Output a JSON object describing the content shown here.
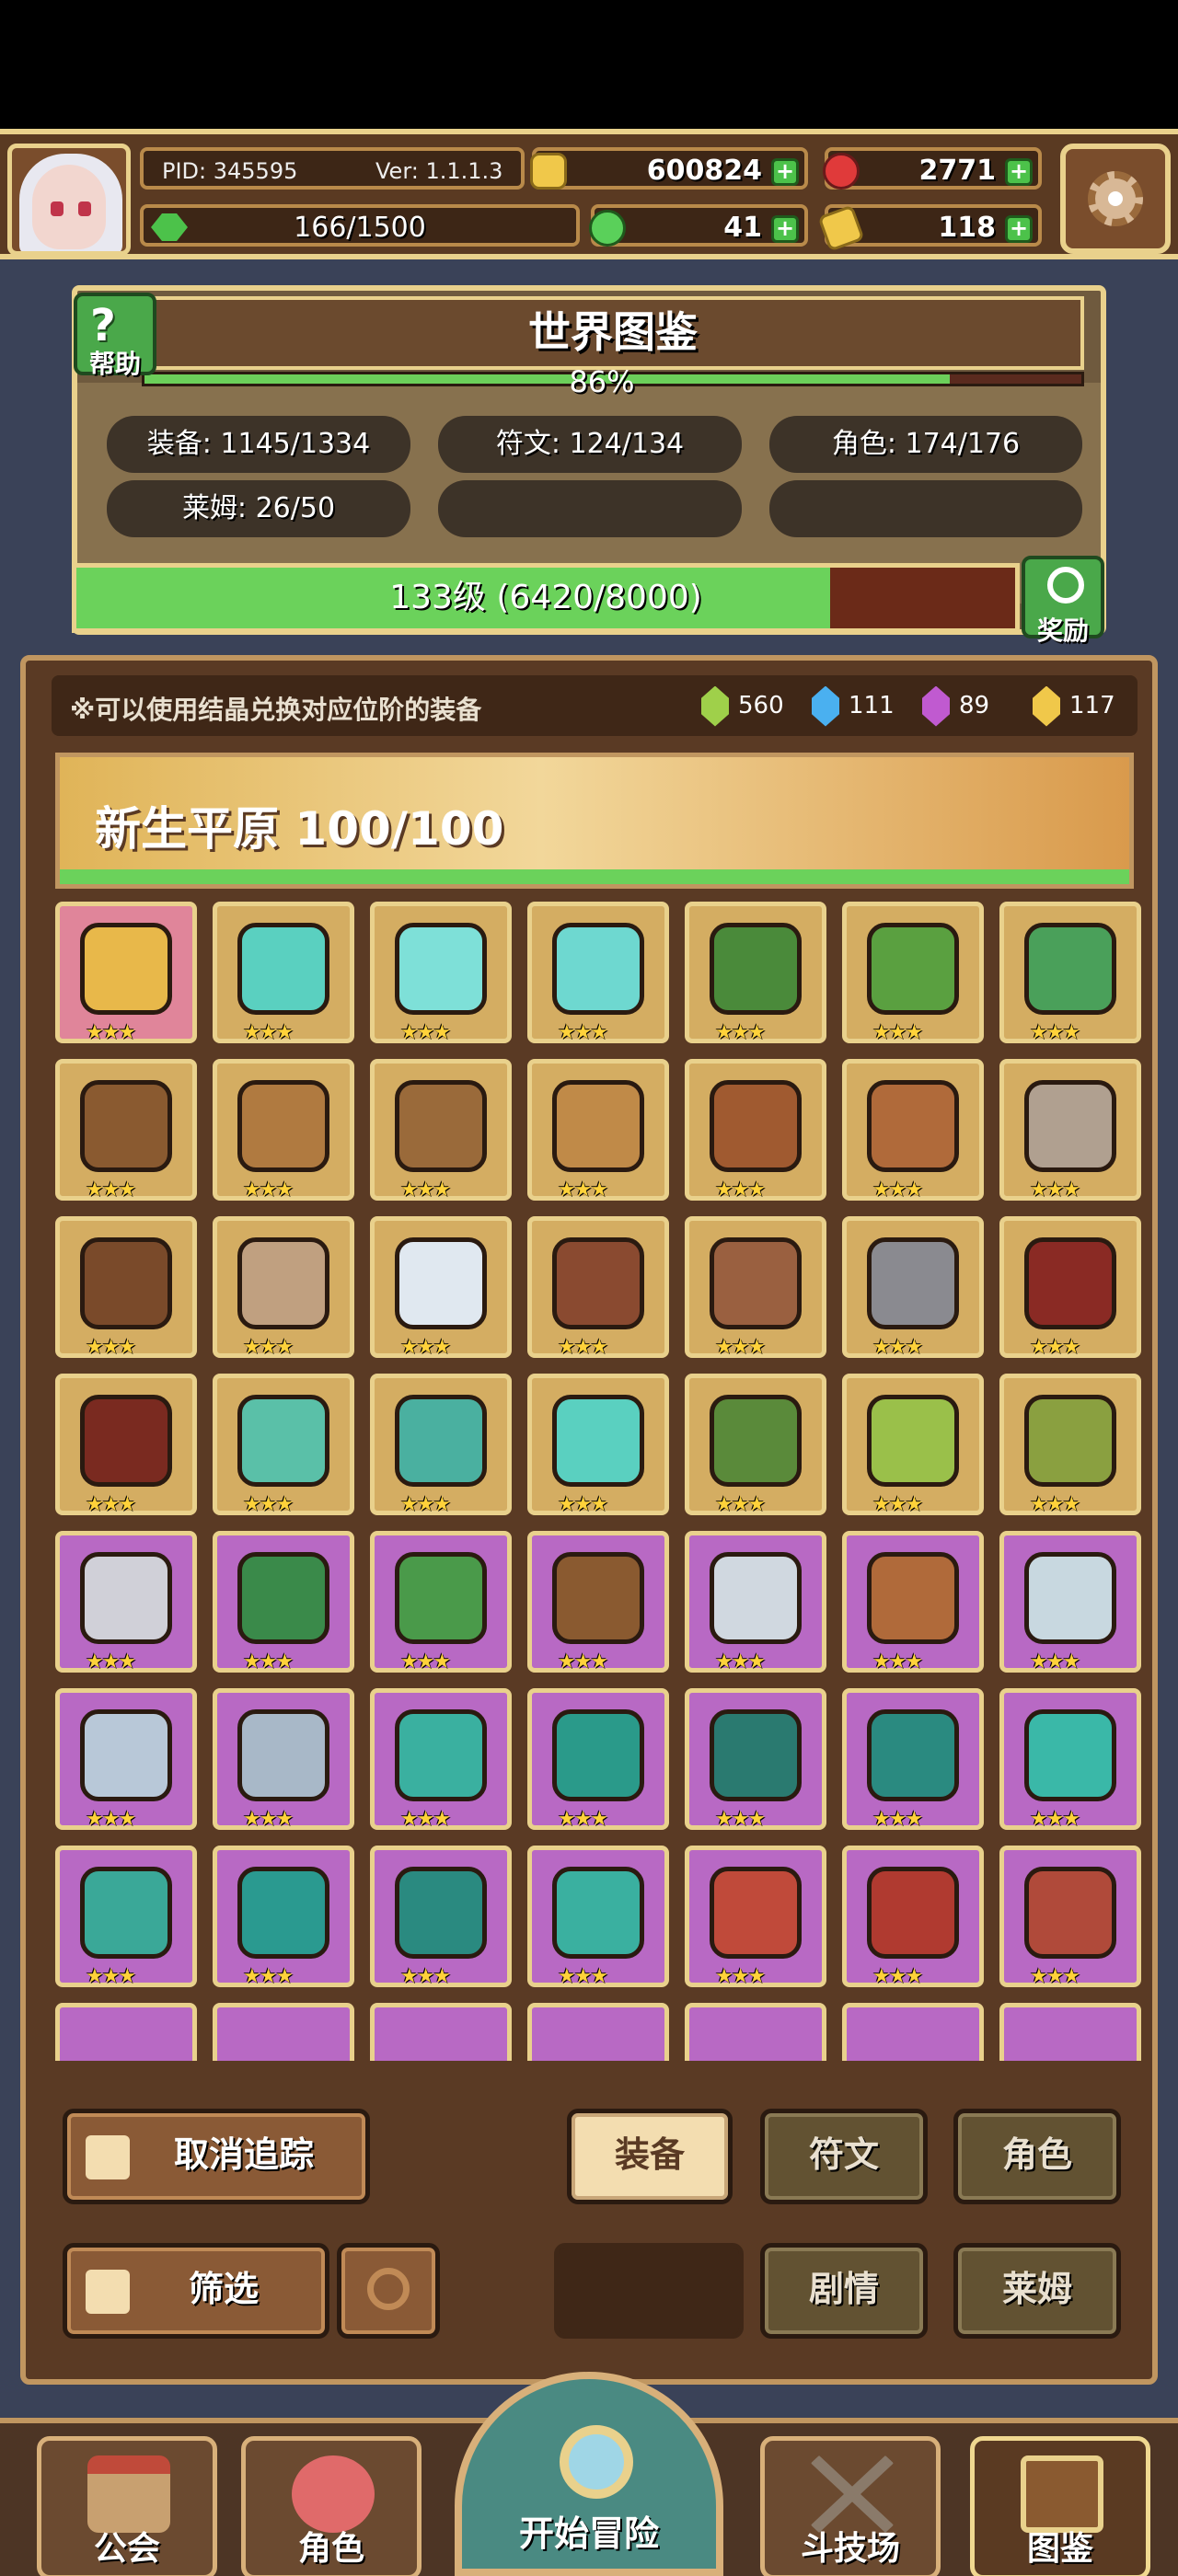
{
  "header": {
    "pid": "PID: 345595",
    "version": "Ver: 1.1.1.3",
    "stamina": "166/1500",
    "gold": "600824",
    "gems": "2771",
    "clover": "41",
    "tickets": "118"
  },
  "atlas": {
    "title": "世界图鉴",
    "help_label": "帮助",
    "progress_text": "86%",
    "progress_value": 0.86,
    "stats": {
      "equipment": "装备: 1145/1334",
      "runes": "符文: 124/134",
      "characters": "角色: 174/176",
      "slimes": "莱姆: 26/50"
    },
    "level_text": "133级 (6420/8000)",
    "level_value": 0.8025,
    "reward_label": "奖励"
  },
  "equipment": {
    "notice": "※可以使用结晶兑换对应位阶的装备",
    "crystals": [
      {
        "value": "560",
        "color": "#9fd04a"
      },
      {
        "value": "111",
        "color": "#4ab0f0"
      },
      {
        "value": "89",
        "color": "#c05ad0"
      },
      {
        "value": "117",
        "color": "#f0c84a"
      }
    ],
    "region": "新生平原  100/100",
    "stars": "★★★",
    "items": [
      {
        "name": "straw-hat",
        "rarity": "pink",
        "color": "#e8b84a"
      },
      {
        "name": "crystal-staff",
        "rarity": "gold",
        "color": "#5ad0c0"
      },
      {
        "name": "crystal-orb",
        "rarity": "gold",
        "color": "#7ee0d8"
      },
      {
        "name": "crystal-gem",
        "rarity": "gold",
        "color": "#6ed8d0"
      },
      {
        "name": "green-hood",
        "rarity": "gold",
        "color": "#4a8a3a"
      },
      {
        "name": "green-armor",
        "rarity": "gold",
        "color": "#5aa040"
      },
      {
        "name": "jade-ring",
        "rarity": "gold",
        "color": "#4aa05a"
      },
      {
        "name": "crossbow",
        "rarity": "gold",
        "color": "#8a5a30"
      },
      {
        "name": "wooden-spear",
        "rarity": "gold",
        "color": "#b07a40"
      },
      {
        "name": "heart-amulet",
        "rarity": "gold",
        "color": "#9a6a3a"
      },
      {
        "name": "wooden-wand",
        "rarity": "gold",
        "color": "#c08a48"
      },
      {
        "name": "bronze-ring",
        "rarity": "gold",
        "color": "#a05a30"
      },
      {
        "name": "gem-ring",
        "rarity": "gold",
        "color": "#b06a3a"
      },
      {
        "name": "battle-axe",
        "rarity": "gold",
        "color": "#b0a090"
      },
      {
        "name": "leather-belt",
        "rarity": "gold",
        "color": "#7a4a2a"
      },
      {
        "name": "silver-ring",
        "rarity": "gold",
        "color": "#c0a080"
      },
      {
        "name": "pearl-orb",
        "rarity": "gold",
        "color": "#e0e8f0"
      },
      {
        "name": "war-hammer",
        "rarity": "gold",
        "color": "#8a4a30"
      },
      {
        "name": "bone-necklace",
        "rarity": "gold",
        "color": "#9a6040"
      },
      {
        "name": "steel-spear",
        "rarity": "gold",
        "color": "#8a8a90"
      },
      {
        "name": "red-hood",
        "rarity": "gold",
        "color": "#8a2a24"
      },
      {
        "name": "red-cape",
        "rarity": "gold",
        "color": "#7a2a20"
      },
      {
        "name": "jade-bow",
        "rarity": "gold",
        "color": "#5ac0a8"
      },
      {
        "name": "jade-arrow",
        "rarity": "gold",
        "color": "#4ab0a0"
      },
      {
        "name": "jade-boots",
        "rarity": "gold",
        "color": "#5ad0c0"
      },
      {
        "name": "green-helmet",
        "rarity": "gold",
        "color": "#5a8a3a"
      },
      {
        "name": "green-scroll",
        "rarity": "gold",
        "color": "#9ac04a"
      },
      {
        "name": "green-crown",
        "rarity": "gold",
        "color": "#8aa040"
      },
      {
        "name": "steel-sword",
        "rarity": "purple",
        "color": "#d0d0d8"
      },
      {
        "name": "green-cloak",
        "rarity": "purple",
        "color": "#3a8a4a"
      },
      {
        "name": "green-vest",
        "rarity": "purple",
        "color": "#4a9a4a"
      },
      {
        "name": "hunter-bow",
        "rarity": "purple",
        "color": "#8a5a30"
      },
      {
        "name": "silver-spear",
        "rarity": "purple",
        "color": "#d0d8e0"
      },
      {
        "name": "leather-gloves",
        "rarity": "purple",
        "color": "#b06a3a"
      },
      {
        "name": "silver-armor",
        "rarity": "purple",
        "color": "#c8d8e0"
      },
      {
        "name": "silver-belt",
        "rarity": "purple",
        "color": "#b8c8d8"
      },
      {
        "name": "silver-gauntlets",
        "rarity": "purple",
        "color": "#a8b8c8"
      },
      {
        "name": "teal-scepter",
        "rarity": "purple",
        "color": "#3ab0a0"
      },
      {
        "name": "teal-hat",
        "rarity": "purple",
        "color": "#2a9a8a"
      },
      {
        "name": "teal-armor",
        "rarity": "purple",
        "color": "#2a7a70"
      },
      {
        "name": "teal-bracer",
        "rarity": "purple",
        "color": "#2a8a80"
      },
      {
        "name": "teal-ring",
        "rarity": "purple",
        "color": "#3ab8a8"
      },
      {
        "name": "teal-boots",
        "rarity": "purple",
        "color": "#3aa898"
      },
      {
        "name": "teal-star",
        "rarity": "purple",
        "color": "#2a9a90"
      },
      {
        "name": "teal-necklace",
        "rarity": "purple",
        "color": "#2a8a80"
      },
      {
        "name": "teal-charm",
        "rarity": "purple",
        "color": "#3ab0a0"
      },
      {
        "name": "red-mask",
        "rarity": "purple",
        "color": "#c04a3a"
      },
      {
        "name": "red-robe",
        "rarity": "purple",
        "color": "#b03a30"
      },
      {
        "name": "red-boots",
        "rarity": "purple",
        "color": "#b04a3a"
      }
    ]
  },
  "controls": {
    "untrack": "取消追踪",
    "filter": "筛选",
    "tab_equipment": "装备",
    "tab_runes": "符文",
    "tab_characters": "角色",
    "tab_story": "剧情",
    "tab_slime": "莱姆"
  },
  "nav": {
    "guild": "公会",
    "character": "角色",
    "adventure": "开始冒险",
    "arena": "斗技场",
    "codex": "图鉴"
  }
}
